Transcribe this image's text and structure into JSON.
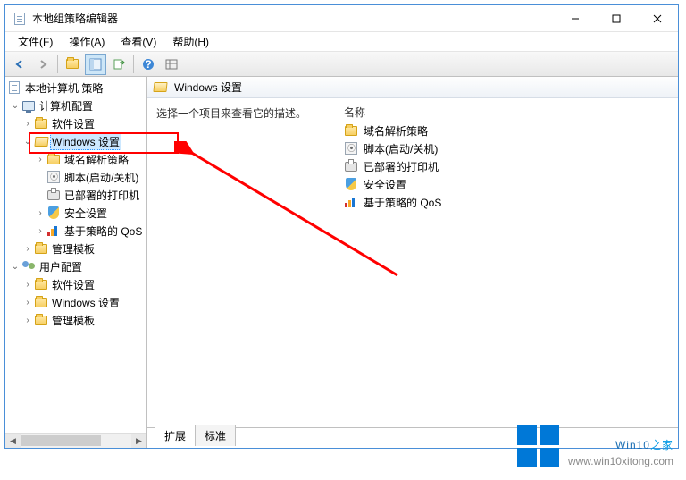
{
  "window": {
    "title": "本地组策略编辑器"
  },
  "menu": {
    "file": "文件(F)",
    "action": "操作(A)",
    "view": "查看(V)",
    "help": "帮助(H)"
  },
  "tree": {
    "root": "本地计算机 策略",
    "computer": "计算机配置",
    "software1": "软件设置",
    "windows1": "Windows 设置",
    "dns": "域名解析策略",
    "script": "脚本(启动/关机)",
    "printer": "已部署的打印机",
    "security": "安全设置",
    "qos": "基于策略的 QoS",
    "admin1": "管理模板",
    "user": "用户配置",
    "software2": "软件设置",
    "windows2": "Windows 设置",
    "admin2": "管理模板"
  },
  "content": {
    "header": "Windows 设置",
    "desc": "选择一个项目来查看它的描述。",
    "name_col": "名称",
    "items": {
      "dns": "域名解析策略",
      "script": "脚本(启动/关机)",
      "printer": "已部署的打印机",
      "security": "安全设置",
      "qos": "基于策略的 QoS"
    },
    "tab_extended": "扩展",
    "tab_standard": "标准"
  },
  "watermark": {
    "brand_a": "Win10",
    "brand_b": "之家",
    "url": "www.win10xitong.com"
  }
}
